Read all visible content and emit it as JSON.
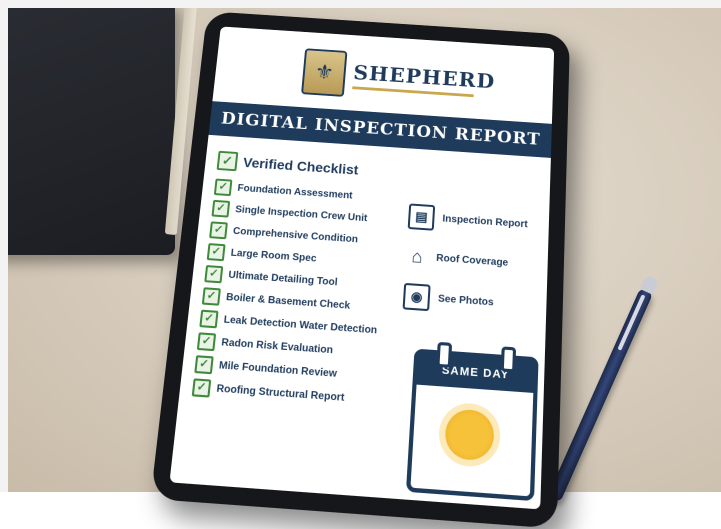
{
  "brand": {
    "name": "SHEPHERD"
  },
  "banner": {
    "title": "DIGITAL INSPECTION REPORT"
  },
  "checklist": {
    "heading": "Verified Checklist",
    "items": [
      "Foundation Assessment",
      "Single Inspection Crew Unit",
      "Comprehensive Condition",
      "Large Room Spec",
      "Ultimate Detailing Tool",
      "Boiler & Basement Check",
      "Leak Detection Water Detection",
      "Radon Risk Evaluation",
      "Mile Foundation Review",
      "Roofing Structural Report"
    ]
  },
  "features": [
    {
      "icon": "document-icon",
      "label": "Inspection Report"
    },
    {
      "icon": "roof-icon",
      "label": "Roof Coverage"
    },
    {
      "icon": "camera-icon",
      "label": "See Photos"
    }
  ],
  "calendar": {
    "label": "SAME DAY"
  },
  "colors": {
    "navy": "#1f3b5c",
    "gold": "#c9a84d",
    "check_green": "#3f8a3a",
    "sun": "#f6c23a"
  }
}
